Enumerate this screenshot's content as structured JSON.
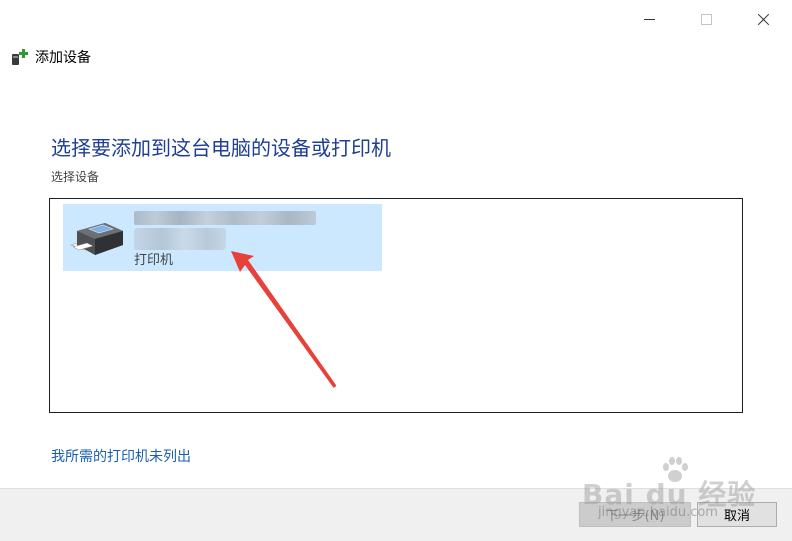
{
  "window": {
    "title": "添加设备",
    "controls": {
      "minimize": "minimize-icon",
      "maximize": "maximize-icon",
      "close": "close-icon"
    }
  },
  "main": {
    "heading": "选择要添加到这台电脑的设备或打印机",
    "subheading": "选择设备",
    "devices": [
      {
        "name": "",
        "type": "打印机",
        "icon": "printer-icon",
        "selected": true
      }
    ],
    "not_listed_link": "我所需的打印机未列出"
  },
  "footer": {
    "next_label": "下一步(N)",
    "cancel_label": "取消"
  },
  "watermark": {
    "brand": "Bai du 经验",
    "url": "jingyan.baidu.com"
  },
  "colors": {
    "heading": "#1f3f95",
    "link": "#1a5fb4",
    "selection": "#cce8ff",
    "annotation_arrow": "#e8413a"
  }
}
